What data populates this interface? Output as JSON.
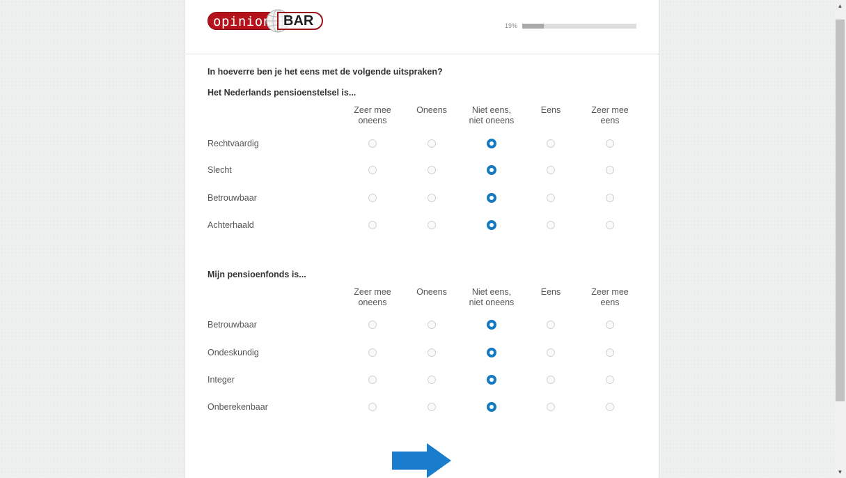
{
  "logo": {
    "left_text": "opinion",
    "right_text": "BAR"
  },
  "progress": {
    "label": "19%",
    "value": 0.19
  },
  "question": "In hoeverre ben je het eens met de volgende uitspraken?",
  "scale": [
    "Zeer mee oneens",
    "Oneens",
    "Niet eens, niet oneens",
    "Eens",
    "Zeer mee eens"
  ],
  "scale_lines": [
    [
      "Zeer mee",
      "oneens"
    ],
    [
      "Oneens"
    ],
    [
      "Niet eens,",
      "niet oneens"
    ],
    [
      "Eens"
    ],
    [
      "Zeer mee",
      "eens"
    ]
  ],
  "groups": [
    {
      "title": "Het Nederlands pensioenstelsel is...",
      "rows": [
        {
          "label": "Rechtvaardig",
          "selected": 2
        },
        {
          "label": "Slecht",
          "selected": 2
        },
        {
          "label": "Betrouwbaar",
          "selected": 2
        },
        {
          "label": "Achterhaald",
          "selected": 2
        }
      ]
    },
    {
      "title": "Mijn pensioenfonds is...",
      "rows": [
        {
          "label": "Betrouwbaar",
          "selected": 2
        },
        {
          "label": "Ondeskundig",
          "selected": 2
        },
        {
          "label": "Integer",
          "selected": 2
        },
        {
          "label": "Onberekenbaar",
          "selected": 2
        }
      ]
    }
  ],
  "next_button": {
    "icon": "arrow-right-icon",
    "color": "#1a7ccc"
  },
  "colors": {
    "accent": "#1479c0",
    "brand_red": "#b5121b"
  }
}
